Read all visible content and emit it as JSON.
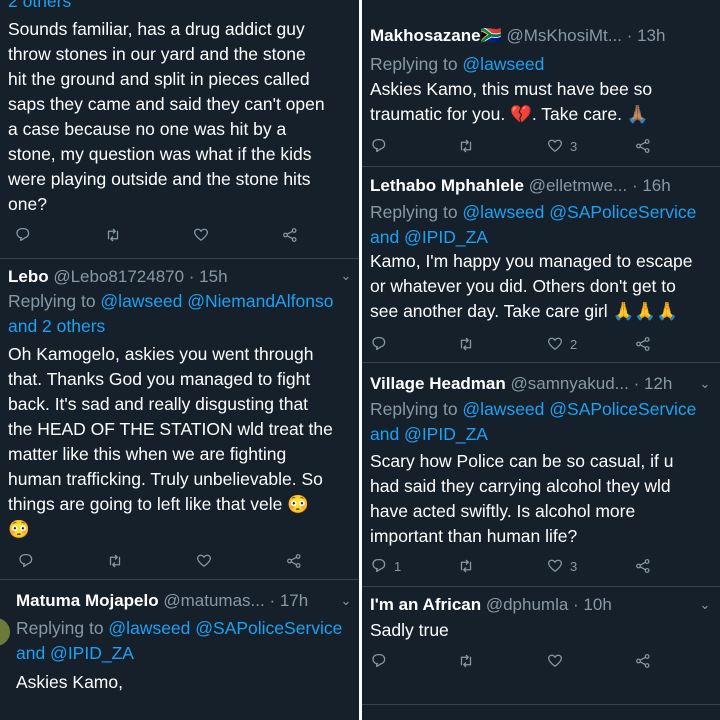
{
  "left": {
    "top_fragment": "2 others",
    "tweet1": {
      "body": "Sounds familiar, has a drug addict guy\nthrow stones in our yard and the stone\nhit the ground and split in pieces called\nsaps they came and said they can't open\na case because no one was hit by a\nstone, my question was what if the kids\nwere playing outside and the stone hits\none?"
    },
    "tweet2": {
      "name": "Lebo",
      "handle": "@Lebo81724870",
      "time": "· 15h",
      "reply_prefix": "Replying to ",
      "reply_to": "@lawseed @NiemandAlfonso",
      "reply_line2": "and 2 others",
      "body": "Oh Kamogelo, askies you went through\nthat. Thanks God you managed to fight\nback. It's sad and really disgusting that\nthe HEAD OF THE STATION wld treat the\nmatter like this when we are fighting\nhuman trafficking. Truly unbelievable. So\nthings are going to left like that vele 😳\n😳"
    },
    "tweet3": {
      "name": "Matuma Mojapelo",
      "handle": "@matumas...",
      "time": "· 17h",
      "reply_prefix": "Replying to ",
      "reply_to": "@lawseed @SAPoliceService",
      "reply_line2": "and @IPID_ZA",
      "body": "Askies Kamo,"
    }
  },
  "right": {
    "tweet1": {
      "name": "Makhosazane🇿🇦",
      "handle": "@MsKhosiMt...",
      "time": "· 13h",
      "reply_prefix": "Replying to ",
      "reply_to": "@lawseed",
      "body": "Askies Kamo, this must have bee so\ntraumatic for you. 💔. Take care. 🙏🏽",
      "like_count": "3"
    },
    "tweet2": {
      "name": "Lethabo Mphahlele",
      "handle": "@elletmwe...",
      "time": "· 16h",
      "reply_prefix": "Replying to ",
      "reply_to": "@lawseed @SAPoliceService",
      "reply_line2": "and @IPID_ZA",
      "body": "Kamo, I'm happy you managed to escape\nor whatever you did. Others don't get to\nsee another day. Take care girl 🙏🙏🙏",
      "like_count": "2"
    },
    "tweet3": {
      "name": "Village Headman",
      "handle": "@samnyakud...",
      "time": "· 12h",
      "reply_prefix": "Replying to ",
      "reply_to": "@lawseed @SAPoliceService",
      "reply_line2": "and @IPID_ZA",
      "body": "Scary how Police can be so casual, if u\nhad said they carrying alcohol they wld\nhave acted swiftly. Is alcohol more\nimportant than human life?",
      "reply_count": "1",
      "like_count": "3"
    },
    "tweet4": {
      "name": "I'm an African",
      "handle": "@dphumla",
      "time": "· 10h",
      "body": "Sadly true"
    }
  },
  "icons": [
    "reply-icon",
    "retweet-icon",
    "like-icon",
    "share-icon",
    "chevron-down-icon"
  ],
  "colors": {
    "background": "#15202b",
    "link": "#1da1f2",
    "muted": "#8899a6",
    "divider": "#38444d"
  }
}
